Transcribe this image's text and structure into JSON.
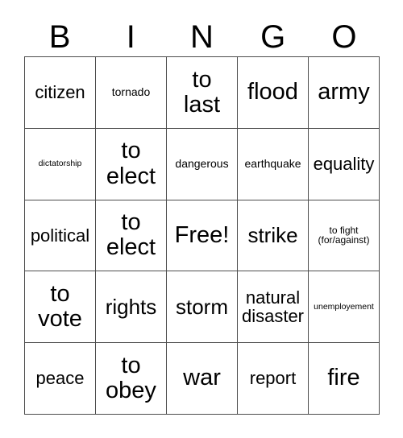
{
  "card": {
    "type": "bingo-card",
    "columns": 5,
    "rows": 5,
    "background_color": "#ffffff",
    "border_color": "#4d4d4d",
    "text_color": "#000000"
  },
  "header": {
    "letters": [
      {
        "label": "B"
      },
      {
        "label": "I"
      },
      {
        "label": "N"
      },
      {
        "label": "G"
      },
      {
        "label": "O"
      }
    ]
  },
  "grid": {
    "cells": [
      {
        "text": "citizen",
        "size": "sz-md",
        "free": false
      },
      {
        "text": "tornado",
        "size": "sz-xs",
        "free": false
      },
      {
        "text": "to\nlast",
        "size": "sz-xl",
        "free": false
      },
      {
        "text": "flood",
        "size": "sz-xl",
        "free": false
      },
      {
        "text": "army",
        "size": "sz-xl",
        "free": false
      },
      {
        "text": "dictatorship",
        "size": "sz-tiny",
        "free": false
      },
      {
        "text": "to\nelect",
        "size": "sz-xl",
        "free": false
      },
      {
        "text": "dangerous",
        "size": "sz-xs",
        "free": false
      },
      {
        "text": "earthquake",
        "size": "sz-xs",
        "free": false
      },
      {
        "text": "equality",
        "size": "sz-md",
        "free": false
      },
      {
        "text": "political",
        "size": "sz-md",
        "free": false
      },
      {
        "text": "to\nelect",
        "size": "sz-xl",
        "free": false
      },
      {
        "text": "Free!",
        "size": "sz-xl",
        "free": true
      },
      {
        "text": "strike",
        "size": "sz-lg",
        "free": false
      },
      {
        "text": "to fight\n(for/against)",
        "size": "sz-xxs",
        "free": false
      },
      {
        "text": "to\nvote",
        "size": "sz-xl",
        "free": false
      },
      {
        "text": "rights",
        "size": "sz-lg",
        "free": false
      },
      {
        "text": "storm",
        "size": "sz-lg",
        "free": false
      },
      {
        "text": "natural\ndisaster",
        "size": "sz-md",
        "free": false
      },
      {
        "text": "unemployement",
        "size": "sz-tiny",
        "free": false
      },
      {
        "text": "peace",
        "size": "sz-md",
        "free": false
      },
      {
        "text": "to\nobey",
        "size": "sz-xl",
        "free": false
      },
      {
        "text": "war",
        "size": "sz-xl",
        "free": false
      },
      {
        "text": "report",
        "size": "sz-md",
        "free": false
      },
      {
        "text": "fire",
        "size": "sz-xl",
        "free": false
      }
    ]
  }
}
